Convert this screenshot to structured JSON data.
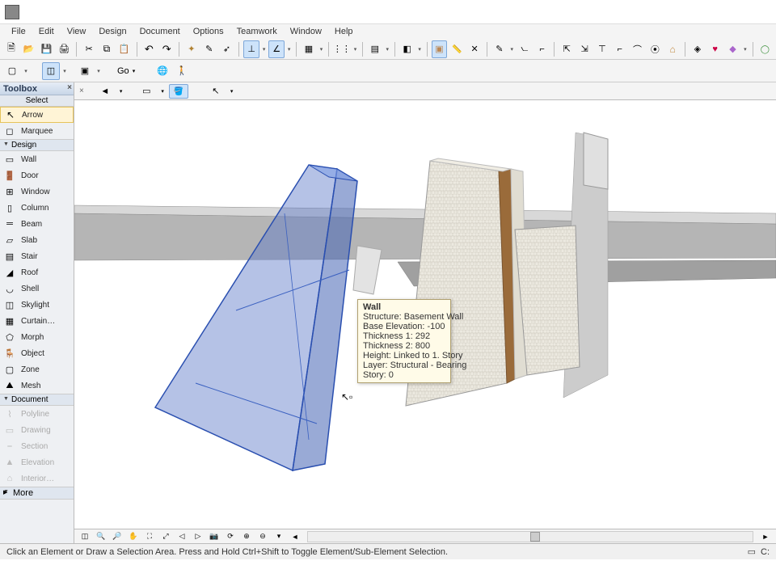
{
  "menubar": [
    "File",
    "Edit",
    "View",
    "Design",
    "Document",
    "Options",
    "Teamwork",
    "Window",
    "Help"
  ],
  "toolbar2": {
    "go": "Go"
  },
  "toolbox": {
    "title": "Toolbox",
    "select_hdr": "Select",
    "arrow": "Arrow",
    "marquee": "Marquee",
    "design_hdr": "Design",
    "wall": "Wall",
    "door": "Door",
    "window": "Window",
    "column": "Column",
    "beam": "Beam",
    "slab": "Slab",
    "stair": "Stair",
    "roof": "Roof",
    "shell": "Shell",
    "skylight": "Skylight",
    "curtain": "Curtain…",
    "morph": "Morph",
    "object": "Object",
    "zone": "Zone",
    "mesh": "Mesh",
    "document_hdr": "Document",
    "polyline": "Polyline",
    "drawing": "Drawing",
    "section": "Section",
    "elevation": "Elevation",
    "interior": "Interior…",
    "more": "More"
  },
  "tooltip": {
    "title": "Wall",
    "l1": "Structure: Basement Wall",
    "l2": "Base Elevation: -100",
    "l3": "Thickness 1: 292",
    "l4": "Thickness 2: 800",
    "l5": "Height: Linked to 1. Story",
    "l6": "Layer: Structural - Bearing",
    "l7": "Story: 0"
  },
  "status": {
    "hint": "Click an Element or Draw a Selection Area. Press and Hold Ctrl+Shift to Toggle Element/Sub-Element Selection.",
    "right": "C:"
  }
}
